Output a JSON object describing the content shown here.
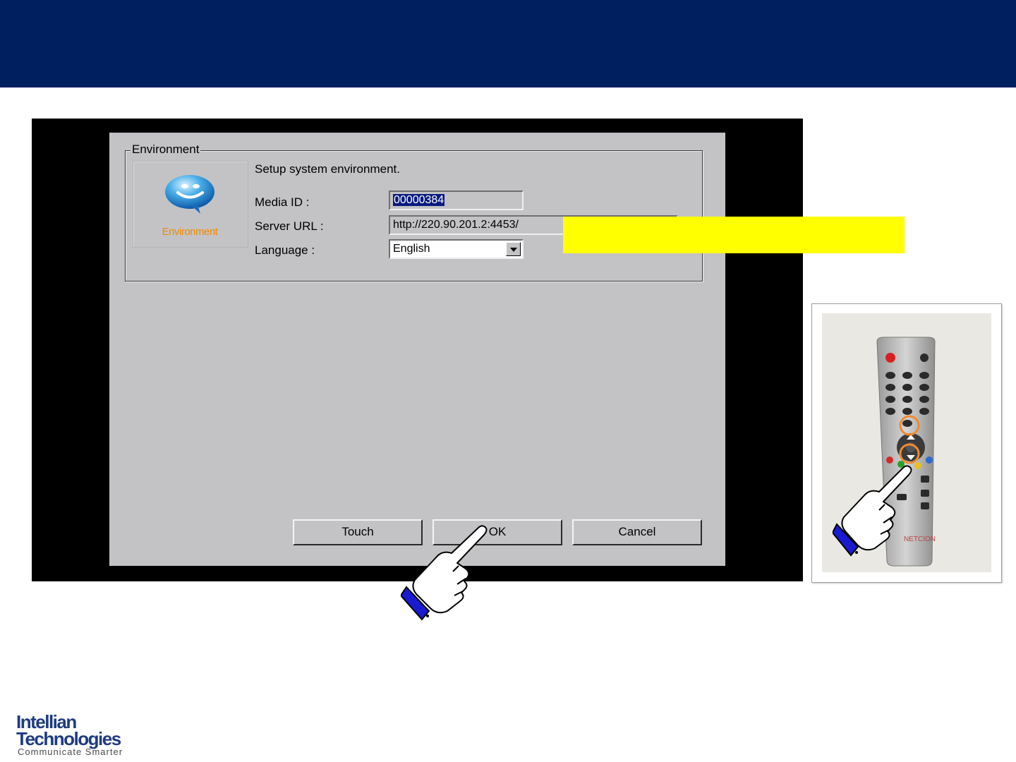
{
  "colors": {
    "header_bar": "#001f5e",
    "highlight": "#ffff00",
    "pointer_cuff": "#1a1ad0",
    "environment_label": "#f08a00",
    "remote_ring": "#f08a30"
  },
  "dialog": {
    "group_title": "Environment",
    "icon": "speech-bubble-smiley-icon",
    "icon_label": "Environment",
    "description": "Setup system environment.",
    "media_id": {
      "label": "Media ID :",
      "value": "00000384"
    },
    "server_url": {
      "label": "Server URL :",
      "value": "http://220.90.201.2:4453/"
    },
    "language": {
      "label": "Language :",
      "value": "English"
    },
    "buttons": {
      "touch": "Touch",
      "ok": "OK",
      "cancel": "Cancel"
    }
  },
  "remote": {
    "brand": "NETCION",
    "icons": [
      "power-button-icon",
      "arrow-up-icon",
      "arrow-down-icon",
      "ok-button-icon"
    ]
  },
  "pointers": [
    "pointing-hand-icon",
    "pointing-hand-icon"
  ],
  "logo": {
    "line1": "Intellian",
    "line2": "Technologies",
    "tagline": "Communicate Smarter"
  }
}
